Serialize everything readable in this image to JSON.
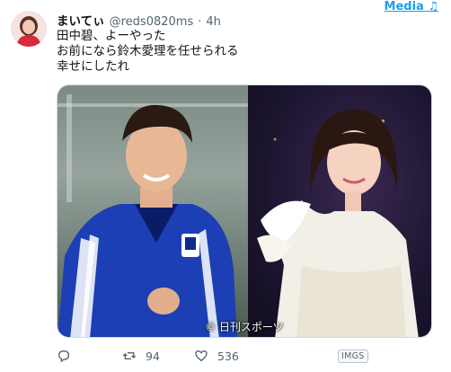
{
  "tweet": {
    "display_name": "まいてぃ",
    "handle": "@reds0820ms",
    "separator": "·",
    "time": "4h",
    "lines": [
      "田中碧、よーやった",
      "お前になら鈴木愛理を任せられる",
      "幸せにしたれ"
    ]
  },
  "media_tab": {
    "label": "Media ♫"
  },
  "media": {
    "credit": "© 日刊スポーツ"
  },
  "actions": {
    "retweets": "94",
    "likes": "536",
    "imgs_badge": "IMGS"
  },
  "colors": {
    "accent": "#1d9bf0",
    "muted": "#536471",
    "text": "#0f1419"
  },
  "icons": [
    "reply-icon",
    "retweet-icon",
    "like-icon"
  ]
}
